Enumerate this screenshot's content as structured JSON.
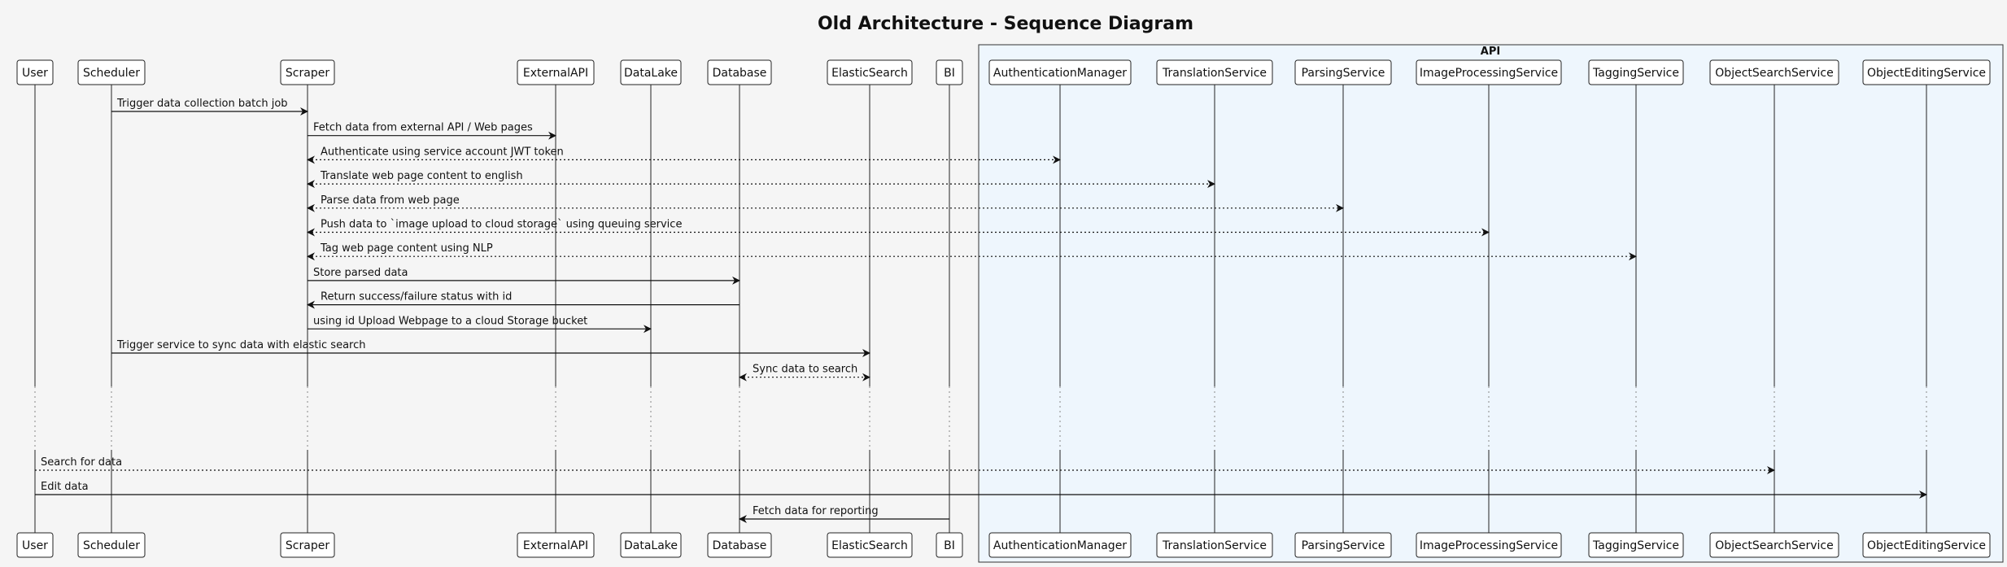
{
  "title": "Old Architecture - Sequence Diagram",
  "group": {
    "label": "API"
  },
  "participants": [
    "User",
    "Scheduler",
    "Scraper",
    "ExternalAPI",
    "DataLake",
    "Database",
    "ElasticSearch",
    "BI",
    "AuthenticationManager",
    "TranslationService",
    "ParsingService",
    "ImageProcessingService",
    "TaggingService",
    "ObjectSearchService",
    "ObjectEditingService"
  ],
  "messages": [
    {
      "from": "Scheduler",
      "to": "Scraper",
      "text": "Trigger data collection batch job",
      "style": "solid",
      "heads": "end"
    },
    {
      "from": "Scraper",
      "to": "ExternalAPI",
      "text": "Fetch data from external API / Web pages",
      "style": "solid",
      "heads": "end"
    },
    {
      "from": "Scraper",
      "to": "AuthenticationManager",
      "text": "Authenticate using service account JWT token",
      "style": "dotted",
      "heads": "both"
    },
    {
      "from": "Scraper",
      "to": "TranslationService",
      "text": "Translate web page content to english",
      "style": "dotted",
      "heads": "both"
    },
    {
      "from": "Scraper",
      "to": "ParsingService",
      "text": "Parse data from web page",
      "style": "dotted",
      "heads": "both"
    },
    {
      "from": "Scraper",
      "to": "ImageProcessingService",
      "text": "Push data to `image upload to cloud storage` using queuing service",
      "style": "dotted",
      "heads": "both"
    },
    {
      "from": "Scraper",
      "to": "TaggingService",
      "text": "Tag web page content using NLP",
      "style": "dotted",
      "heads": "both"
    },
    {
      "from": "Scraper",
      "to": "Database",
      "text": "Store parsed data",
      "style": "solid",
      "heads": "end"
    },
    {
      "from": "Database",
      "to": "Scraper",
      "text": "Return success/failure status with id",
      "style": "solid",
      "heads": "end"
    },
    {
      "from": "Scraper",
      "to": "DataLake",
      "text": "using id Upload Webpage to a cloud Storage bucket",
      "style": "solid",
      "heads": "end"
    },
    {
      "from": "Scheduler",
      "to": "ElasticSearch",
      "text": "Trigger service to sync data with elastic search",
      "style": "solid",
      "heads": "end"
    },
    {
      "from": "Database",
      "to": "ElasticSearch",
      "text": "Sync data to search",
      "style": "dotted",
      "heads": "both"
    },
    {
      "from": "User",
      "to": "ObjectSearchService",
      "text": "Search for data",
      "style": "dotted",
      "heads": "end"
    },
    {
      "from": "User",
      "to": "ObjectEditingService",
      "text": "Edit data",
      "style": "solid",
      "heads": "end"
    },
    {
      "from": "BI",
      "to": "Database",
      "text": "Fetch data for reporting",
      "style": "solid",
      "heads": "end"
    }
  ]
}
